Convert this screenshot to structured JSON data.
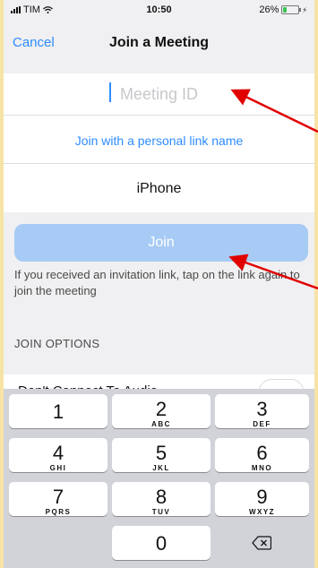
{
  "status_bar": {
    "carrier": "TIM",
    "time": "10:50",
    "battery": "26%",
    "battery_level": 0.26
  },
  "nav": {
    "cancel_label": "Cancel",
    "title": "Join a Meeting"
  },
  "form": {
    "meeting_id_placeholder": "Meeting ID",
    "personal_link_label": "Join with a personal link name",
    "display_name": "iPhone",
    "join_label": "Join",
    "helper_text": "If you received an invitation link, tap on the link again to join the meeting"
  },
  "options": {
    "header": "JOIN OPTIONS",
    "dont_connect_audio_label": "Don't Connect To Audio"
  },
  "keypad": [
    {
      "digit": "1",
      "letters": ""
    },
    {
      "digit": "2",
      "letters": "ABC"
    },
    {
      "digit": "3",
      "letters": "DEF"
    },
    {
      "digit": "4",
      "letters": "GHI"
    },
    {
      "digit": "5",
      "letters": "JKL"
    },
    {
      "digit": "6",
      "letters": "MNO"
    },
    {
      "digit": "7",
      "letters": "PQRS"
    },
    {
      "digit": "8",
      "letters": "TUV"
    },
    {
      "digit": "9",
      "letters": "WXYZ"
    },
    {
      "digit": "0",
      "letters": ""
    }
  ],
  "colors": {
    "accent": "#2d8cff",
    "join_button": "#a7cbf4",
    "annotation_arrow": "#e00000",
    "frame": "#f8e3a6"
  }
}
